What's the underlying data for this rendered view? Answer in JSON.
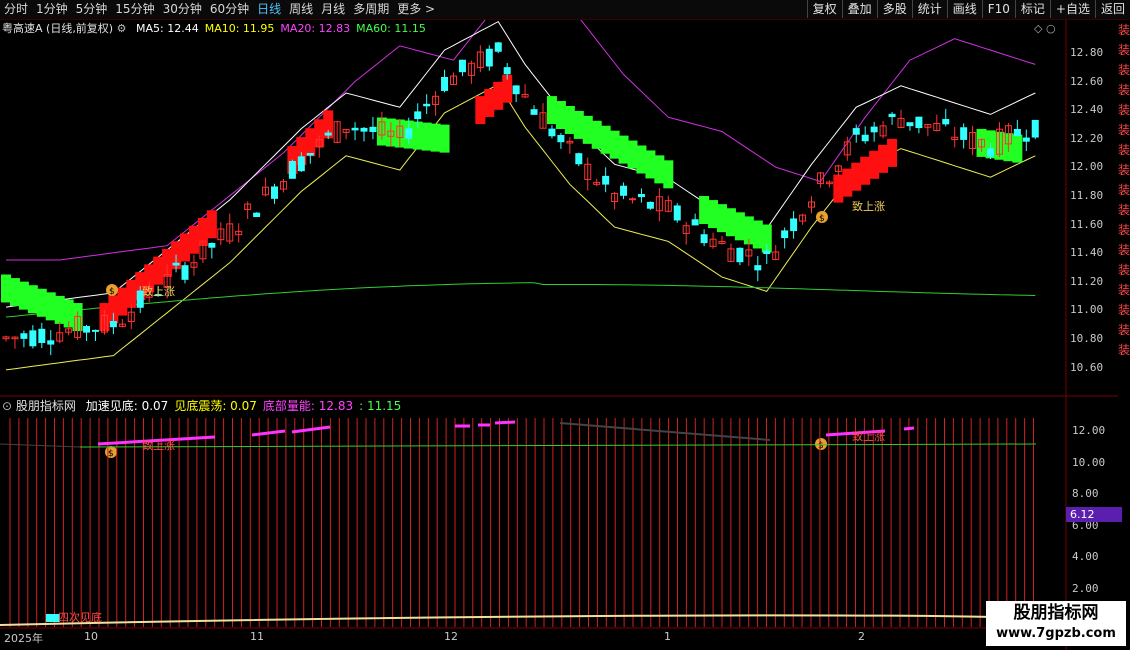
{
  "toolbar": {
    "periods": [
      "分时",
      "1分钟",
      "5分钟",
      "15分钟",
      "30分钟",
      "60分钟",
      "日线",
      "周线",
      "月线",
      "多周期",
      "更多 >"
    ],
    "active_period": "日线",
    "right_buttons": [
      "复权",
      "叠加",
      "多股",
      "统计",
      "画线",
      "F10",
      "标记",
      "+自选",
      "返回"
    ]
  },
  "main_chart": {
    "stock_title": "粤高速A (日线,前复权)",
    "ma_legend": [
      {
        "label": "MA5: 12.44",
        "color": "#ffffff"
      },
      {
        "label": "MA10: 11.95",
        "color": "#ffff00"
      },
      {
        "label": "MA20: 12.83",
        "color": "#ff44ff"
      },
      {
        "label": "MA60: 11.15",
        "color": "#44ff44"
      }
    ],
    "y_ticks": [
      "12.80",
      "12.60",
      "12.40",
      "12.20",
      "12.00",
      "11.80",
      "11.60",
      "11.40",
      "11.20",
      "11.00",
      "10.80",
      "10.60"
    ],
    "annotations": [
      "致上涨",
      "致上涨"
    ]
  },
  "indicator": {
    "title": "股朋指标网",
    "legend": [
      {
        "label": "加速见底: 0.07",
        "color": "#ffffff"
      },
      {
        "label": "见底震荡: 0.07",
        "color": "#ffff00"
      },
      {
        "label": "底部量能: 12.83",
        "color": "#ff44ff"
      },
      {
        "label": ": 11.15",
        "color": "#44ff44"
      }
    ],
    "y_ticks": [
      "12.00",
      "10.00",
      "8.00",
      "6.00",
      "4.00",
      "2.00"
    ],
    "current_value": "6.12",
    "annotations": [
      "致上涨",
      "致上涨",
      "四次见底"
    ]
  },
  "x_axis": [
    "2025年",
    "10",
    "11",
    "12",
    "1",
    "2"
  ],
  "watermark": {
    "line1": "股朋指标网",
    "line2": "www.7gpzb.com"
  },
  "side_strip": "装装装装装装装装装装装装装装装装装",
  "colors": {
    "up": "#ff3333",
    "down": "#33ffff",
    "buy_block": "#ff1010",
    "sell_block": "#22ff22",
    "ma5": "#ffffff",
    "ma10": "#ffff44",
    "ma20": "#ff44ff",
    "ma60": "#44ff44"
  }
}
